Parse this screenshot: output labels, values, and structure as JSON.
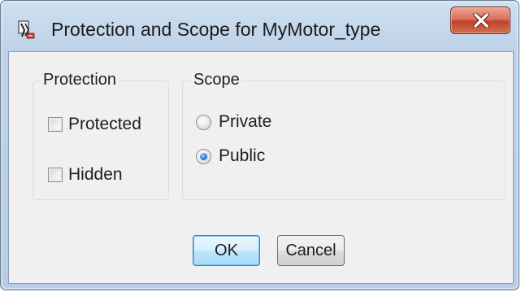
{
  "window": {
    "title": "Protection and Scope for MyMotor_type",
    "icon": "app-icon",
    "close_icon": "close-icon"
  },
  "protection": {
    "group_label": "Protection",
    "options": [
      {
        "label": "Protected",
        "checked": false
      },
      {
        "label": "Hidden",
        "checked": false
      }
    ]
  },
  "scope": {
    "group_label": "Scope",
    "options": [
      {
        "label": "Private",
        "selected": false
      },
      {
        "label": "Public",
        "selected": true
      }
    ]
  },
  "buttons": {
    "ok_label": "OK",
    "cancel_label": "Cancel"
  },
  "colors": {
    "title_bar": "#c3d6eb",
    "close_button": "#c9523c",
    "client_background": "#f0f0f0",
    "default_button": "#bee6fd"
  }
}
